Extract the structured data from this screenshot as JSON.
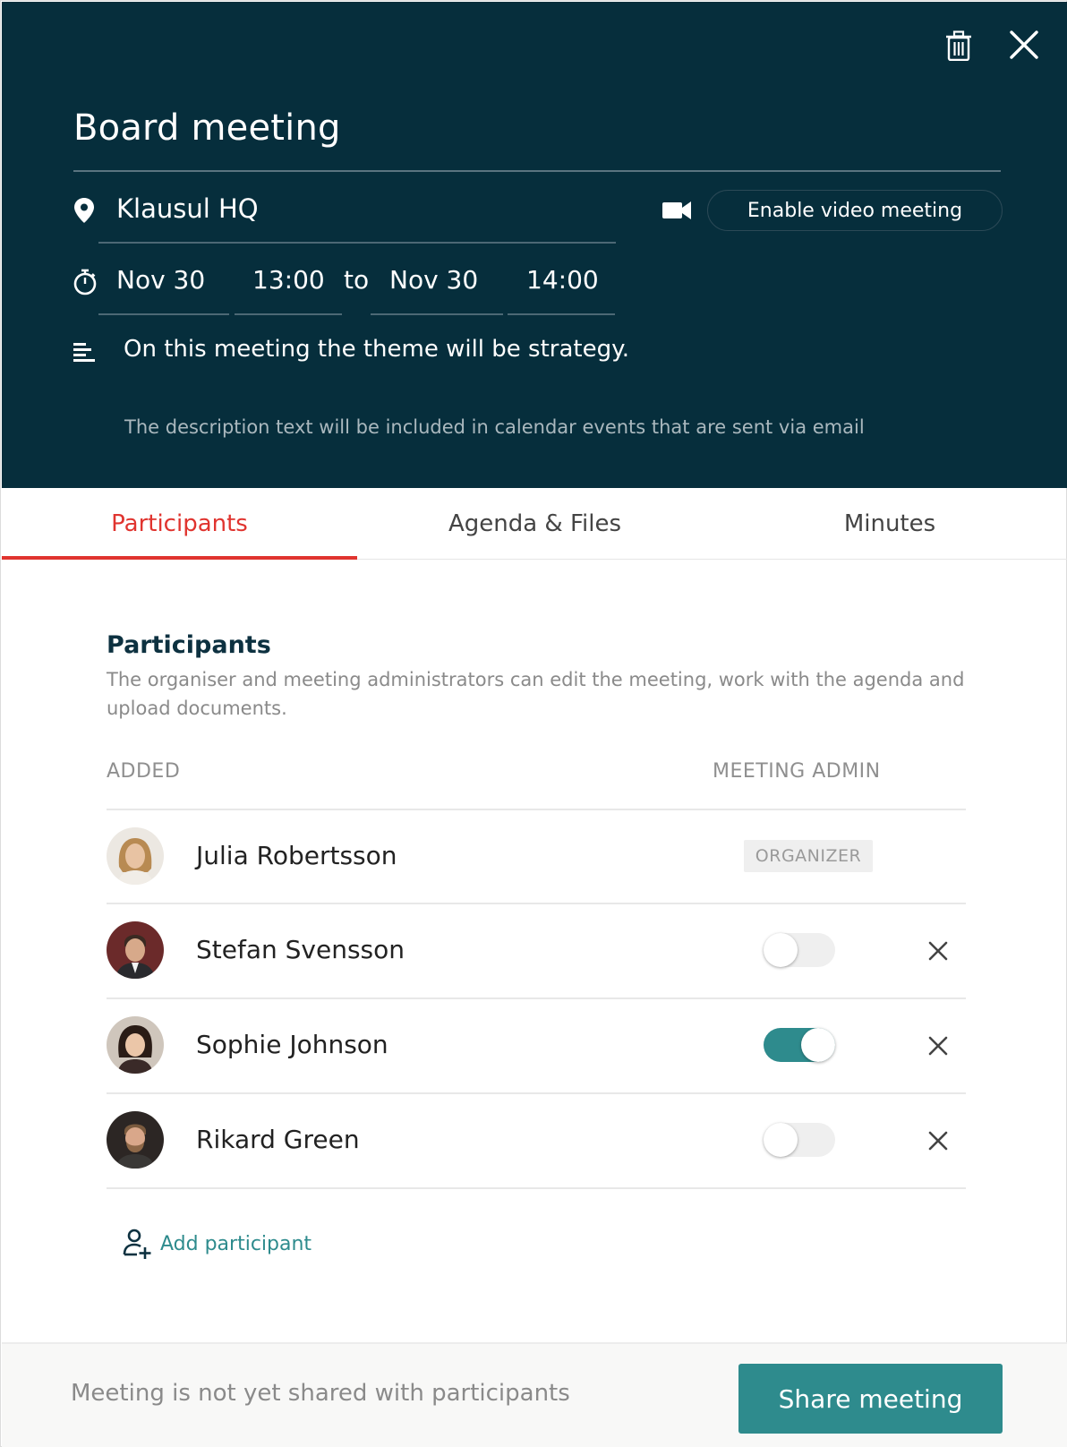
{
  "header": {
    "title": "Board meeting",
    "location": "Klausul HQ",
    "video_button": "Enable video meeting",
    "start_date": "Nov 30",
    "start_time": "13:00",
    "to_label": "to",
    "end_date": "Nov 30",
    "end_time": "14:00",
    "description": "On this meeting the theme will be strategy.",
    "description_hint": "The description text will be included in calendar events that are sent via email",
    "icons": [
      "trash-icon",
      "close-icon",
      "location-pin-icon",
      "video-camera-icon",
      "stopwatch-icon",
      "text-lines-icon"
    ]
  },
  "tabs": [
    {
      "label": "Participants",
      "active": true
    },
    {
      "label": "Agenda & Files",
      "active": false
    },
    {
      "label": "Minutes",
      "active": false
    }
  ],
  "participants_section": {
    "title": "Participants",
    "description": "The organiser and meeting administrators can edit the meeting, work with the agenda and upload documents.",
    "col_added": "ADDED",
    "col_admin": "MEETING ADMIN",
    "rows": [
      {
        "name": "Julia Robertsson",
        "role": "ORGANIZER"
      },
      {
        "name": "Stefan Svensson",
        "admin": false
      },
      {
        "name": "Sophie Johnson",
        "admin": true
      },
      {
        "name": "Rikard Green",
        "admin": false
      }
    ],
    "add_label": "Add participant"
  },
  "footer": {
    "status": "Meeting is not yet shared with participants",
    "share_button": "Share meeting"
  },
  "colors": {
    "header_bg": "#062e3c",
    "accent_red": "#e0342f",
    "teal": "#2e8b8d"
  }
}
